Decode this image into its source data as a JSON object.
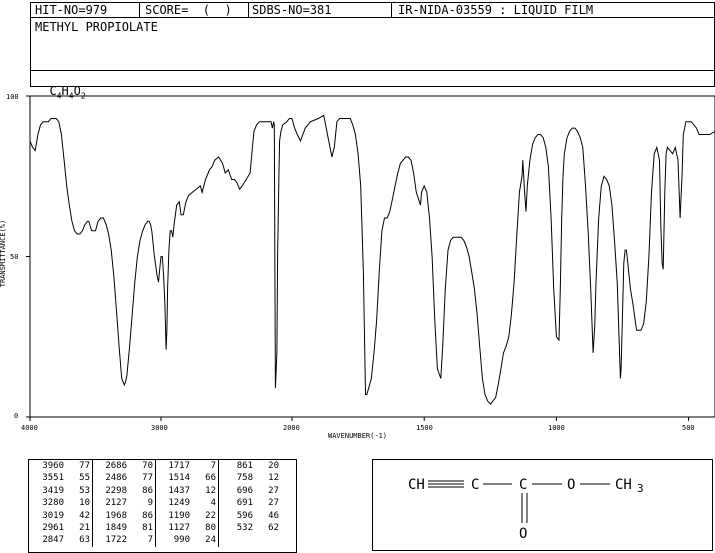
{
  "header": {
    "hit_no": "HIT-NO=979",
    "score": "SCORE=  (  )",
    "sdbs_no": "SDBS-NO=381",
    "ir_info": "IR-NIDA-03559 : LIQUID FILM"
  },
  "compound": {
    "name": "METHYL PROPIOLATE",
    "formula_parts": [
      "C",
      "4",
      "H",
      "4",
      "O",
      "2"
    ]
  },
  "chart_data": {
    "type": "line",
    "xlabel": "WAVENUMBER(-1)",
    "ylabel": "TRANSMITTANCE(%)",
    "xlim": [
      4000,
      400
    ],
    "ylim": [
      0,
      100
    ],
    "x_ticks": [
      "4000",
      "3000",
      "2000",
      "1500",
      "1000",
      "500"
    ],
    "y_ticks": [
      "100",
      "50",
      "0"
    ],
    "series": [
      {
        "points": [
          [
            4000,
            86
          ],
          [
            3980,
            84
          ],
          [
            3960,
            83
          ],
          [
            3940,
            88
          ],
          [
            3920,
            91
          ],
          [
            3900,
            92
          ],
          [
            3880,
            92
          ],
          [
            3860,
            92
          ],
          [
            3840,
            93
          ],
          [
            3800,
            93
          ],
          [
            3780,
            92
          ],
          [
            3760,
            88
          ],
          [
            3740,
            80
          ],
          [
            3720,
            72
          ],
          [
            3700,
            66
          ],
          [
            3680,
            61
          ],
          [
            3660,
            58
          ],
          [
            3640,
            57
          ],
          [
            3620,
            57
          ],
          [
            3600,
            58
          ],
          [
            3580,
            60
          ],
          [
            3560,
            61
          ],
          [
            3551,
            61
          ],
          [
            3530,
            58
          ],
          [
            3500,
            58
          ],
          [
            3480,
            61
          ],
          [
            3460,
            62
          ],
          [
            3440,
            62
          ],
          [
            3419,
            60
          ],
          [
            3400,
            57
          ],
          [
            3380,
            52
          ],
          [
            3360,
            44
          ],
          [
            3340,
            33
          ],
          [
            3320,
            22
          ],
          [
            3300,
            12
          ],
          [
            3280,
            10
          ],
          [
            3270,
            11
          ],
          [
            3260,
            13
          ],
          [
            3240,
            22
          ],
          [
            3220,
            32
          ],
          [
            3200,
            42
          ],
          [
            3180,
            50
          ],
          [
            3160,
            55
          ],
          [
            3140,
            58
          ],
          [
            3120,
            60
          ],
          [
            3100,
            61
          ],
          [
            3090,
            61
          ],
          [
            3080,
            60
          ],
          [
            3070,
            58
          ],
          [
            3060,
            54
          ],
          [
            3050,
            50
          ],
          [
            3040,
            47
          ],
          [
            3030,
            44
          ],
          [
            3019,
            42
          ],
          [
            3010,
            46
          ],
          [
            3000,
            50
          ],
          [
            2990,
            50
          ],
          [
            2980,
            44
          ],
          [
            2970,
            35
          ],
          [
            2961,
            21
          ],
          [
            2955,
            27
          ],
          [
            2950,
            40
          ],
          [
            2940,
            52
          ],
          [
            2930,
            58
          ],
          [
            2920,
            58
          ],
          [
            2910,
            56
          ],
          [
            2900,
            60
          ],
          [
            2880,
            66
          ],
          [
            2860,
            67
          ],
          [
            2847,
            63
          ],
          [
            2830,
            63
          ],
          [
            2810,
            67
          ],
          [
            2790,
            69
          ],
          [
            2760,
            70
          ],
          [
            2730,
            71
          ],
          [
            2700,
            72
          ],
          [
            2686,
            70
          ],
          [
            2660,
            74
          ],
          [
            2630,
            77
          ],
          [
            2610,
            78
          ],
          [
            2590,
            80
          ],
          [
            2560,
            81
          ],
          [
            2530,
            79
          ],
          [
            2510,
            76
          ],
          [
            2486,
            77
          ],
          [
            2460,
            74
          ],
          [
            2440,
            74
          ],
          [
            2420,
            73
          ],
          [
            2400,
            71
          ],
          [
            2380,
            72
          ],
          [
            2350,
            74
          ],
          [
            2320,
            76
          ],
          [
            2298,
            86
          ],
          [
            2290,
            89
          ],
          [
            2270,
            91
          ],
          [
            2250,
            92
          ],
          [
            2220,
            92
          ],
          [
            2200,
            92
          ],
          [
            2180,
            92
          ],
          [
            2160,
            92
          ],
          [
            2150,
            90
          ],
          [
            2140,
            92
          ],
          [
            2135,
            91
          ],
          [
            2127,
            9
          ],
          [
            2115,
            20
          ],
          [
            2110,
            50
          ],
          [
            2100,
            75
          ],
          [
            2095,
            86
          ],
          [
            2085,
            89
          ],
          [
            2070,
            91
          ],
          [
            2040,
            92
          ],
          [
            2020,
            93
          ],
          [
            2000,
            93
          ],
          [
            1990,
            90
          ],
          [
            1980,
            88
          ],
          [
            1968,
            86
          ],
          [
            1950,
            90
          ],
          [
            1930,
            92
          ],
          [
            1900,
            93
          ],
          [
            1880,
            94
          ],
          [
            1849,
            81
          ],
          [
            1840,
            84
          ],
          [
            1830,
            92
          ],
          [
            1820,
            93
          ],
          [
            1800,
            93
          ],
          [
            1780,
            93
          ],
          [
            1770,
            91
          ],
          [
            1760,
            88
          ],
          [
            1750,
            82
          ],
          [
            1740,
            72
          ],
          [
            1730,
            45
          ],
          [
            1722,
            7
          ],
          [
            1717,
            7
          ],
          [
            1710,
            9
          ],
          [
            1700,
            12
          ],
          [
            1690,
            20
          ],
          [
            1680,
            30
          ],
          [
            1670,
            45
          ],
          [
            1660,
            58
          ],
          [
            1650,
            62
          ],
          [
            1640,
            62
          ],
          [
            1630,
            64
          ],
          [
            1620,
            68
          ],
          [
            1610,
            72
          ],
          [
            1600,
            76
          ],
          [
            1590,
            79
          ],
          [
            1580,
            80
          ],
          [
            1570,
            81
          ],
          [
            1560,
            81
          ],
          [
            1550,
            80
          ],
          [
            1540,
            76
          ],
          [
            1530,
            70
          ],
          [
            1514,
            66
          ],
          [
            1510,
            70
          ],
          [
            1500,
            72
          ],
          [
            1490,
            70
          ],
          [
            1480,
            62
          ],
          [
            1470,
            50
          ],
          [
            1460,
            30
          ],
          [
            1450,
            15
          ],
          [
            1437,
            12
          ],
          [
            1430,
            22
          ],
          [
            1420,
            40
          ],
          [
            1410,
            52
          ],
          [
            1400,
            55
          ],
          [
            1390,
            56
          ],
          [
            1380,
            56
          ],
          [
            1370,
            56
          ],
          [
            1360,
            56
          ],
          [
            1350,
            55
          ],
          [
            1340,
            53
          ],
          [
            1330,
            50
          ],
          [
            1320,
            45
          ],
          [
            1310,
            40
          ],
          [
            1300,
            32
          ],
          [
            1290,
            22
          ],
          [
            1280,
            12
          ],
          [
            1270,
            7
          ],
          [
            1260,
            5
          ],
          [
            1249,
            4
          ],
          [
            1240,
            5
          ],
          [
            1230,
            6
          ],
          [
            1220,
            10
          ],
          [
            1210,
            15
          ],
          [
            1200,
            20
          ],
          [
            1190,
            22
          ],
          [
            1180,
            25
          ],
          [
            1170,
            32
          ],
          [
            1160,
            42
          ],
          [
            1150,
            56
          ],
          [
            1140,
            70
          ],
          [
            1130,
            75
          ],
          [
            1127,
            80
          ],
          [
            1120,
            70
          ],
          [
            1115,
            64
          ],
          [
            1110,
            72
          ],
          [
            1100,
            80
          ],
          [
            1090,
            85
          ],
          [
            1080,
            87
          ],
          [
            1070,
            88
          ],
          [
            1060,
            88
          ],
          [
            1050,
            87
          ],
          [
            1040,
            84
          ],
          [
            1030,
            78
          ],
          [
            1020,
            62
          ],
          [
            1010,
            40
          ],
          [
            1000,
            25
          ],
          [
            990,
            24
          ],
          [
            985,
            40
          ],
          [
            980,
            62
          ],
          [
            975,
            75
          ],
          [
            970,
            82
          ],
          [
            960,
            87
          ],
          [
            950,
            89
          ],
          [
            940,
            90
          ],
          [
            930,
            90
          ],
          [
            920,
            89
          ],
          [
            910,
            87
          ],
          [
            900,
            84
          ],
          [
            890,
            72
          ],
          [
            880,
            58
          ],
          [
            870,
            40
          ],
          [
            861,
            20
          ],
          [
            855,
            28
          ],
          [
            850,
            42
          ],
          [
            840,
            62
          ],
          [
            830,
            72
          ],
          [
            820,
            75
          ],
          [
            810,
            74
          ],
          [
            800,
            72
          ],
          [
            790,
            66
          ],
          [
            780,
            55
          ],
          [
            770,
            42
          ],
          [
            758,
            12
          ],
          [
            755,
            15
          ],
          [
            750,
            32
          ],
          [
            745,
            48
          ],
          [
            740,
            52
          ],
          [
            735,
            52
          ],
          [
            730,
            48
          ],
          [
            720,
            40
          ],
          [
            710,
            35
          ],
          [
            700,
            29
          ],
          [
            696,
            27
          ],
          [
            691,
            27
          ],
          [
            680,
            27
          ],
          [
            670,
            29
          ],
          [
            660,
            36
          ],
          [
            650,
            50
          ],
          [
            640,
            70
          ],
          [
            630,
            82
          ],
          [
            620,
            84
          ],
          [
            610,
            80
          ],
          [
            605,
            60
          ],
          [
            600,
            48
          ],
          [
            596,
            46
          ],
          [
            590,
            70
          ],
          [
            585,
            82
          ],
          [
            580,
            84
          ],
          [
            570,
            83
          ],
          [
            560,
            82
          ],
          [
            550,
            84
          ],
          [
            540,
            80
          ],
          [
            532,
            62
          ],
          [
            525,
            75
          ],
          [
            520,
            88
          ],
          [
            510,
            92
          ],
          [
            500,
            92
          ],
          [
            490,
            92
          ],
          [
            480,
            91
          ],
          [
            470,
            90
          ],
          [
            460,
            88
          ],
          [
            440,
            88
          ],
          [
            420,
            88
          ],
          [
            400,
            89
          ]
        ]
      }
    ]
  },
  "peaks": {
    "columns": [
      [
        [
          "3960",
          "77"
        ],
        [
          "3551",
          "55"
        ],
        [
          "3419",
          "53"
        ],
        [
          "3280",
          "10"
        ],
        [
          "3019",
          "42"
        ],
        [
          "2961",
          "21"
        ],
        [
          "2847",
          "63"
        ]
      ],
      [
        [
          "2686",
          "70"
        ],
        [
          "2486",
          "77"
        ],
        [
          "2298",
          "86"
        ],
        [
          "2127",
          "9"
        ],
        [
          "1968",
          "86"
        ],
        [
          "1849",
          "81"
        ],
        [
          "1722",
          "7"
        ]
      ],
      [
        [
          "1717",
          "7"
        ],
        [
          "1514",
          "66"
        ],
        [
          "1437",
          "12"
        ],
        [
          "1249",
          "4"
        ],
        [
          "1190",
          "22"
        ],
        [
          "1127",
          "80"
        ],
        [
          "990",
          "24"
        ]
      ],
      [
        [
          "861",
          "20"
        ],
        [
          "758",
          "12"
        ],
        [
          "696",
          "27"
        ],
        [
          "691",
          "27"
        ],
        [
          "596",
          "46"
        ],
        [
          "532",
          "62"
        ]
      ]
    ]
  },
  "structure": {
    "atoms": [
      "CH",
      "C",
      "C",
      "O",
      "CH",
      "3",
      "O"
    ]
  }
}
